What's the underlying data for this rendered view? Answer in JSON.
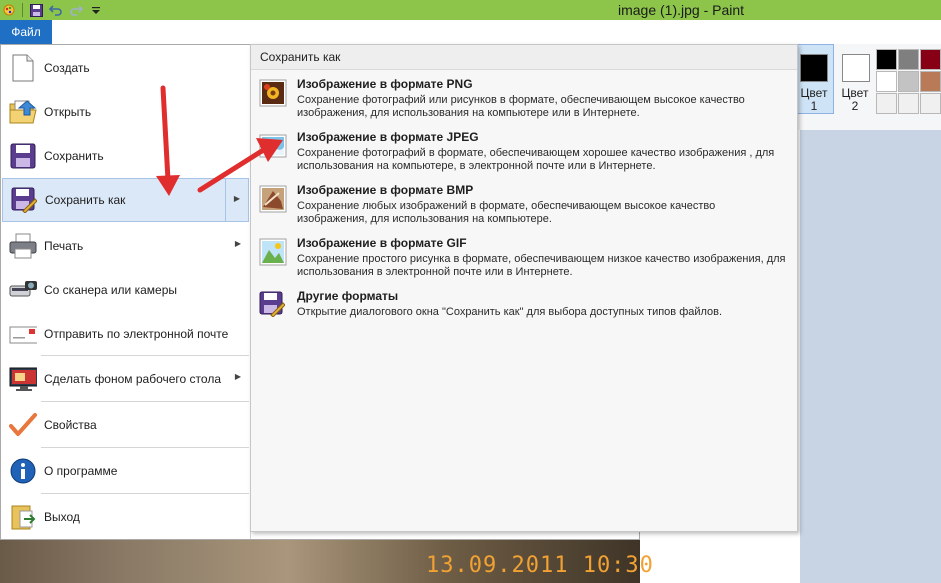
{
  "window": {
    "title": "image (1).jpg - Paint"
  },
  "quick_access": [
    "paint-icon",
    "save-icon",
    "undo-icon",
    "redo-icon",
    "customize-icon"
  ],
  "file_tab": {
    "label": "Файл"
  },
  "ribbon": {
    "color1_label": "Цвет 1",
    "color2_label": "Цвет 2",
    "palette": [
      "#000000",
      "#7f7f7f",
      "#880015",
      "#ffffff",
      "#c3c3c3",
      "#b97a57",
      "#f0f0f0",
      "#f0f0f0",
      "#f0f0f0"
    ]
  },
  "photo": {
    "timestamp": "13.09.2011 10:30"
  },
  "file_menu": {
    "items": [
      {
        "label": "Создать",
        "icon": "new-document-icon",
        "submenu": false
      },
      {
        "label": "Открыть",
        "icon": "open-folder-icon",
        "submenu": false
      },
      {
        "label": "Сохранить",
        "icon": "save-icon",
        "submenu": false
      },
      {
        "label": "Сохранить как",
        "icon": "save-as-icon",
        "submenu": true,
        "active": true
      },
      {
        "label": "Печать",
        "icon": "printer-icon",
        "submenu": true
      },
      {
        "label": "Со сканера или камеры",
        "icon": "scanner-icon",
        "submenu": false
      },
      {
        "label": "Отправить по электронной почте",
        "icon": "email-icon",
        "submenu": false
      },
      {
        "label": "Сделать фоном рабочего стола",
        "icon": "desktop-icon",
        "submenu": true
      },
      {
        "label": "Свойства",
        "icon": "checkmark-icon",
        "submenu": false
      },
      {
        "label": "О программе",
        "icon": "info-icon",
        "submenu": false
      },
      {
        "label": "Выход",
        "icon": "exit-icon",
        "submenu": false
      }
    ]
  },
  "save_as_submenu": {
    "header": "Сохранить как",
    "items": [
      {
        "title": "Изображение в формате PNG",
        "desc": "Сохранение фотографий или рисунков в формате, обеспечивающем высокое качество изображения, для использования на компьютере или в Интернете.",
        "icon": "png-icon"
      },
      {
        "title": "Изображение в формате JPEG",
        "desc": "Сохранение фотографий в формате, обеспечивающем хорошее качество изображения , для использования на компьютере, в электронной почте или в Интернете.",
        "icon": "jpeg-icon"
      },
      {
        "title": "Изображение в формате BMP",
        "desc": "Сохранение любых изображений в формате, обеспечивающем высокое качество изображения, для использования на компьютере.",
        "icon": "bmp-icon"
      },
      {
        "title": "Изображение в формате GIF",
        "desc": "Сохранение простого рисунка в формате, обеспечивающем низкое качество изображения, для использования в электронной почте или в Интернете.",
        "icon": "gif-icon"
      },
      {
        "title": "Другие форматы",
        "desc": "Открытие диалогового окна \"Сохранить как\" для выбора доступных типов файлов.",
        "icon": "other-formats-icon"
      }
    ]
  },
  "colors": {
    "accent": "#1f6fc5",
    "titlebar": "#8cc54a",
    "annotation": "#e02d2d"
  }
}
